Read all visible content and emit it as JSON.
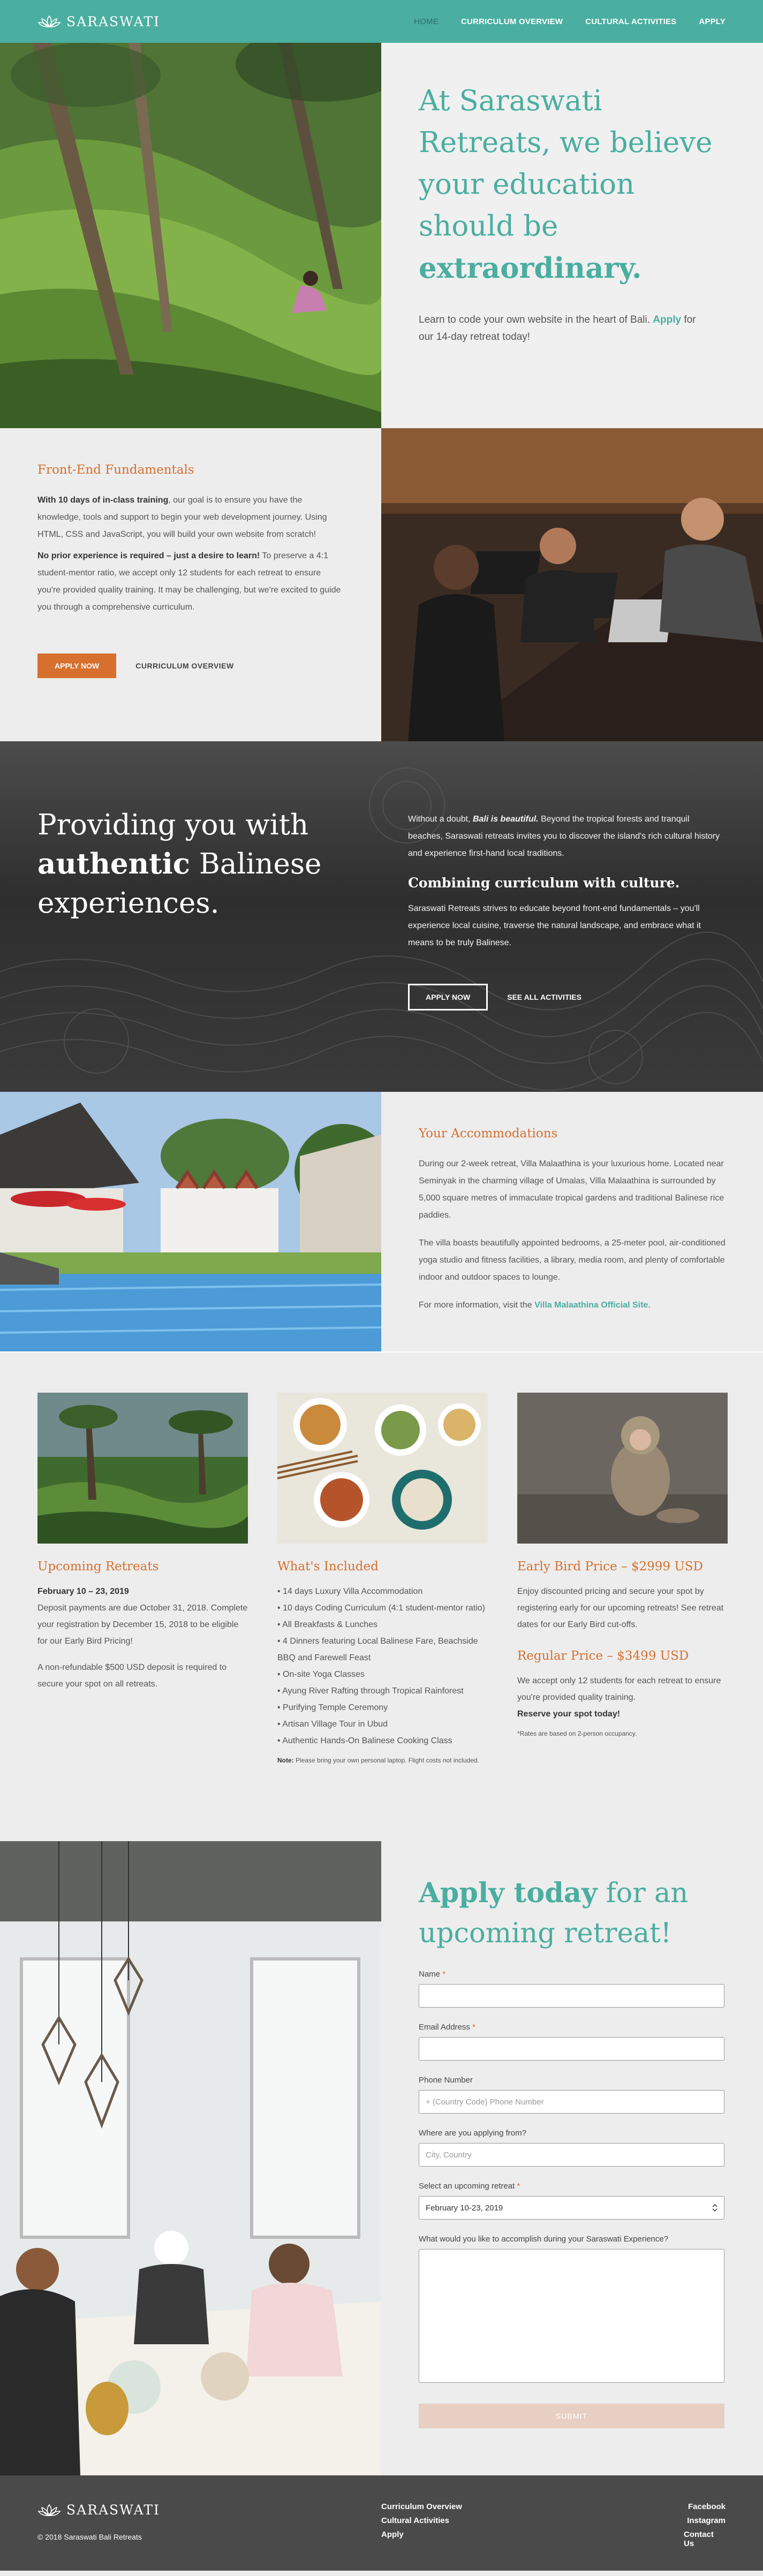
{
  "nav": {
    "brand": "SARASWATI",
    "links": [
      "HOME",
      "CURRICULUM OVERVIEW",
      "CULTURAL ACTIVITIES",
      "APPLY"
    ]
  },
  "hero": {
    "headline": "At Saraswati Retreats, we believe your education should be",
    "headline_bold": "extraordinary.",
    "text_before": "Learn to code your own website in the heart of Bali.",
    "apply_link": "Apply",
    "text_after": "for our 14-day retreat today!"
  },
  "fef": {
    "title": "Front-End Fundamentals",
    "p1_bold": "With 10 days of in-class training",
    "p1": ", our goal is to ensure you have the knowledge, tools and support to begin your web development journey. Using HTML, CSS and JavaScript, you will build your own website from scratch!",
    "p2_bold": "No prior experience is required – just a desire to learn!",
    "p2": " To preserve a 4:1 student-mentor ratio, we accept only 12 students for each retreat to ensure you're provided quality training. It may be challenging, but we're excited to guide you through a comprehensive curriculum.",
    "apply_btn": "APPLY NOW",
    "curriculum_btn": "CURRICULUM OVERVIEW"
  },
  "culture": {
    "h_line1": "Providing you with",
    "h_bold": "authentic",
    "h_line2": " Balinese",
    "h_line3": "experiences.",
    "p1_before": "Without a doubt, ",
    "p1_em": "Bali is beautiful.",
    "p1_after": " Beyond the tropical forests and tranquil beaches, Saraswati retreats invites you to discover the island's rich cultural history and experience first-hand local traditions.",
    "subhead": "Combining curriculum with culture.",
    "p2": "Saraswati Retreats strives to educate beyond front-end fundamentals – you'll experience local cuisine, traverse the natural landscape, and embrace what it means to be truly Balinese.",
    "apply_btn": "APPLY NOW",
    "activities_btn": "SEE ALL ACTIVITIES"
  },
  "accom": {
    "title": "Your Accommodations",
    "p1": "During our 2-week retreat, Villa Malaathina is your luxurious home. Located near Seminyak in the charming village of Umalas, Villa Malaathina is surrounded by 5,000 square metres of immaculate tropical gardens and traditional Balinese rice paddies.",
    "p2": "The villa boasts beautifully appointed bedrooms, a 25-meter pool, air-conditioned yoga studio and fitness facilities, a library, media room, and plenty of comfortable indoor and outdoor spaces to lounge.",
    "p3_before": "For more information, visit the ",
    "p3_link": "Villa Malaathina Official Site",
    "p3_after": "."
  },
  "cards": {
    "upcoming": {
      "title": "Upcoming Retreats",
      "dates": "February 10 – 23, 2019",
      "p1": "Deposit payments are due October 31, 2018. Complete your registration by December 15, 2018 to be eligible for our Early Bird Pricing!",
      "p2": "A non-refundable $500 USD deposit is required to secure your spot on all retreats."
    },
    "included": {
      "title": "What's Included",
      "items": [
        "14 days Luxury Villa Accommodation",
        "10 days Coding Curriculum (4:1 student-mentor ratio)",
        "All Breakfasts & Lunches",
        "4 Dinners featuring Local Balinese Fare, Beachside BBQ and Farewell Feast",
        "On-site Yoga Classes",
        "Ayung River Rafting through Tropical Rainforest",
        "Purifying Temple Ceremony",
        "Artisan Village Tour in Ubud",
        "Authentic Hands-On Balinese Cooking Class"
      ],
      "note_label": "Note:",
      "note": " Please bring your own personal laptop. Flight costs not included."
    },
    "pricing": {
      "early_title": "Early Bird Price – $2999 USD",
      "early_p": "Enjoy discounted pricing and secure your spot by registering early for our upcoming retreats! See retreat dates for our Early Bird cut-offs.",
      "regular_title": "Regular Price – $3499 USD",
      "regular_p": "We accept only 12 students for each retreat to ensure you're provided quality training.",
      "regular_bold": "Reserve your spot today!",
      "footnote": "*Rates are based on 2-person occupancy."
    }
  },
  "form": {
    "h_bold": "Apply today",
    "h_rest": " for an upcoming retreat!",
    "name_label": "Name",
    "email_label": "Email Address",
    "phone_label": "Phone Number",
    "phone_placeholder": "+ (Country Code) Phone Number",
    "from_label": "Where are you applying from?",
    "from_placeholder": "City, Country",
    "retreat_label": "Select an upcoming retreat",
    "retreat_value": "February 10-23, 2019",
    "goal_label": "What would you like to accomplish during your Saraswati Experience?",
    "required_mark": "*",
    "submit": "SUBMIT"
  },
  "footer": {
    "brand": "SARASWATI",
    "copyright": "© 2018 Saraswati Bali Retreats",
    "links1": [
      "Curriculum Overview",
      "Cultural Activities",
      "Apply"
    ],
    "links2": [
      "Facebook",
      "Instagram",
      "Contact Us"
    ]
  },
  "colors": {
    "teal": "#4aaea0",
    "orange": "#d7702e",
    "footer": "#4a4a4a"
  }
}
